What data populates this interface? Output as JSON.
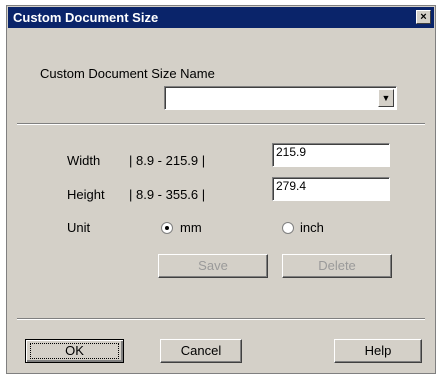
{
  "window": {
    "title": "Custom Document Size",
    "close_glyph": "×"
  },
  "name_section": {
    "label": "Custom Document Size Name",
    "value": "",
    "arrow_glyph": "▼"
  },
  "width": {
    "label": "Width",
    "range": "|  8.9  -  215.9  |",
    "value": "215.9"
  },
  "height": {
    "label": "Height",
    "range": "|  8.9  -  355.6  |",
    "value": "279.4"
  },
  "unit": {
    "label": "Unit",
    "options": [
      {
        "label": "mm",
        "selected": true
      },
      {
        "label": "inch",
        "selected": false
      }
    ]
  },
  "buttons": {
    "save": "Save",
    "delete": "Delete",
    "ok": "OK",
    "cancel": "Cancel",
    "help": "Help"
  }
}
